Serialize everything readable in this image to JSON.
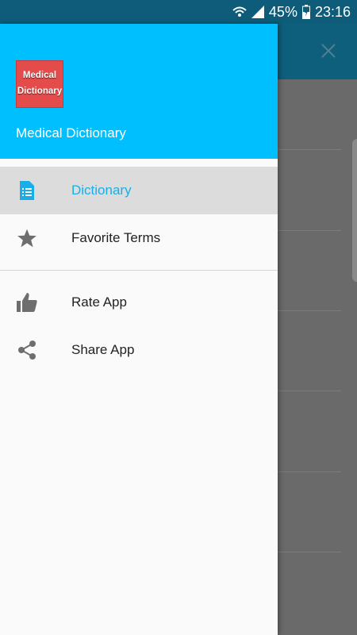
{
  "status_bar": {
    "battery_percent": "45%",
    "time": "23:16",
    "icons": [
      "wifi-icon",
      "signal-icon",
      "battery-charging-icon"
    ]
  },
  "drawer": {
    "logo_lines": [
      "Medical",
      "Dictionary"
    ],
    "header_title": "Medical Dictionary",
    "items": [
      {
        "label": "Dictionary",
        "icon": "document-list-icon",
        "active": true
      },
      {
        "label": "Favorite Terms",
        "icon": "star-icon",
        "active": false
      },
      {
        "label": "Rate App",
        "icon": "thumbs-up-icon",
        "active": false
      },
      {
        "label": "Share App",
        "icon": "share-icon",
        "active": false
      }
    ]
  },
  "colors": {
    "accent": "#00bfff",
    "active_text": "#1aaee8",
    "status_bar": "#0e5c79",
    "logo_bg": "#e44b4b"
  }
}
